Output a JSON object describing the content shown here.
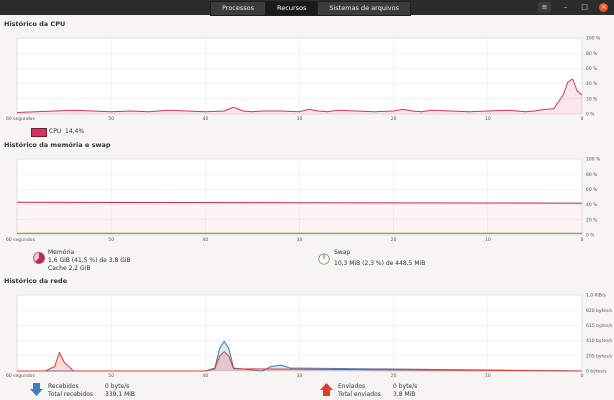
{
  "header": {
    "tabs": [
      {
        "label": "Processos"
      },
      {
        "label": "Recursos"
      },
      {
        "label": "Sistemas de arquivos"
      }
    ],
    "menu_icon": "hamburger-menu-icon",
    "minimize_icon": "minimize-icon",
    "maximize_icon": "maximize-icon",
    "close_icon": "close-icon"
  },
  "cpu": {
    "title": "Histórico da CPU",
    "legend_label": "CPU",
    "legend_value": "14,4%",
    "color": "#d1365c"
  },
  "memory": {
    "title": "Histórico da memória e swap",
    "mem_label": "Memória",
    "mem_line1": "1,6 GiB (41,5 %) de 3,8 GiB",
    "mem_line2": "Cache 2,2 GiB",
    "swap_label": "Swap",
    "swap_line1": "10,3 MiB (2,3 %) de 448,5 MiB",
    "mem_color": "#c0284f",
    "swap_color": "#4a9a3a"
  },
  "network": {
    "title": "Histórico da rede",
    "recv_label": "Recebidos",
    "recv_value": "0 byte/s",
    "recv_total_label": "Total recebidos",
    "recv_total_value": "339,1 MiB",
    "sent_label": "Enviados",
    "sent_value": "0 byte/s",
    "sent_total_label": "Total enviados",
    "sent_total_value": "3,8 MiB",
    "recv_color": "#3f7fc0",
    "sent_color": "#e53b2b"
  },
  "chart_data": [
    {
      "type": "line",
      "title": "Histórico da CPU",
      "x_ticks": [
        "60 segundos",
        "50",
        "40",
        "30",
        "20",
        "10",
        "0"
      ],
      "y_ticks": [
        "100 %",
        "80 %",
        "60 %",
        "40 %",
        "20 %",
        "0 %"
      ],
      "ylim": [
        0,
        100
      ],
      "series": [
        {
          "name": "CPU",
          "x": [
            60,
            58,
            56,
            54,
            52,
            50,
            48,
            46,
            44,
            42,
            40,
            38,
            37,
            36,
            35,
            34,
            32,
            30,
            29,
            28,
            27,
            26,
            24,
            22,
            20,
            19,
            18,
            17,
            16,
            14,
            12,
            10,
            8,
            6,
            5,
            4,
            3,
            2,
            1.5,
            1,
            0.5,
            0
          ],
          "values": [
            2,
            3,
            4,
            5,
            4,
            3,
            4,
            3,
            5,
            4,
            3,
            4,
            9,
            4,
            3,
            4,
            4,
            3,
            6,
            4,
            3,
            5,
            4,
            3,
            4,
            6,
            4,
            3,
            5,
            4,
            3,
            4,
            5,
            3,
            4,
            6,
            7,
            25,
            42,
            46,
            30,
            25
          ]
        }
      ]
    },
    {
      "type": "line",
      "title": "Histórico da memória e swap",
      "x_ticks": [
        "60 segundos",
        "50",
        "40",
        "30",
        "20",
        "10",
        "0"
      ],
      "y_ticks": [
        "100 %",
        "80 %",
        "60 %",
        "40 %",
        "20 %",
        "0 %"
      ],
      "ylim": [
        0,
        100
      ],
      "series": [
        {
          "name": "Memória",
          "x": [
            60,
            30,
            0
          ],
          "values": [
            43,
            42.5,
            42
          ]
        },
        {
          "name": "Swap",
          "x": [
            60,
            30,
            0
          ],
          "values": [
            2.3,
            2.3,
            2.3
          ]
        }
      ]
    },
    {
      "type": "line",
      "title": "Histórico da rede",
      "x_ticks": [
        "60 segundos",
        "50",
        "40",
        "30",
        "20",
        "10",
        "0"
      ],
      "y_ticks": [
        "1,0 KiB/s",
        "820 bytes/s",
        "615 bytes/s",
        "410 bytes/s",
        "205 bytes/s",
        "0 bytes/s"
      ],
      "ylim": [
        0,
        1024
      ],
      "series": [
        {
          "name": "Recebidos",
          "x": [
            60,
            57,
            56,
            55,
            54,
            40,
            39,
            38.5,
            38,
            37.5,
            37,
            34,
            33,
            32,
            31,
            0
          ],
          "values": [
            0,
            0,
            0,
            0,
            0,
            0,
            40,
            300,
            400,
            300,
            40,
            0,
            60,
            80,
            40,
            0
          ]
        },
        {
          "name": "Enviados",
          "x": [
            60,
            57,
            56,
            55.5,
            55,
            54,
            40,
            39,
            38.5,
            38,
            37.5,
            37,
            0
          ],
          "values": [
            0,
            0,
            60,
            250,
            120,
            0,
            0,
            30,
            200,
            260,
            200,
            30,
            0
          ]
        }
      ]
    }
  ]
}
